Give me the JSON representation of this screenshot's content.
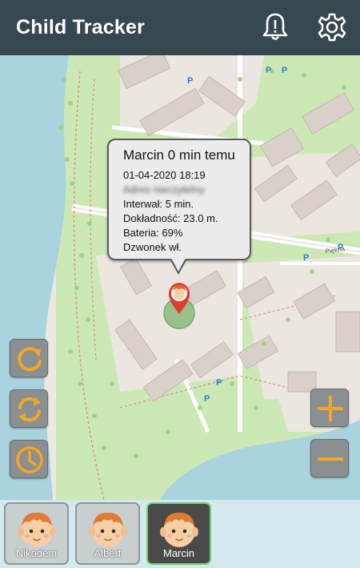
{
  "header": {
    "title": "Child Tracker",
    "notification_icon": "bell-alert-icon",
    "settings_icon": "gear-icon"
  },
  "map": {
    "labels": {
      "street": "Piękna",
      "parking": "P"
    },
    "popup": {
      "title": "Marcin 0 min temu",
      "datetime": "01-04-2020 18:19",
      "address_blurred": "Adres nieczytelny",
      "interval": "Interwał: 5 min.",
      "accuracy": "Dokładność: 23.0 m.",
      "battery": "Bateria: 69%",
      "ringer": "Dzwonek wł."
    }
  },
  "controls": {
    "refresh_icon": "refresh-icon",
    "sync_icon": "sync-icon",
    "history_icon": "clock-icon",
    "zoom_in_icon": "plus-icon",
    "zoom_out_icon": "minus-icon"
  },
  "children": [
    {
      "name": "Nikodem",
      "selected": false
    },
    {
      "name": "Albert",
      "selected": false
    },
    {
      "name": "Marcin",
      "selected": true
    }
  ],
  "colors": {
    "header_bg": "#37474f",
    "accent_orange": "#f5a623",
    "selected_border": "#6fd36f",
    "water": "#a9d3df",
    "park": "#c8e6b4",
    "bottom_bar": "#d3e9ee"
  }
}
